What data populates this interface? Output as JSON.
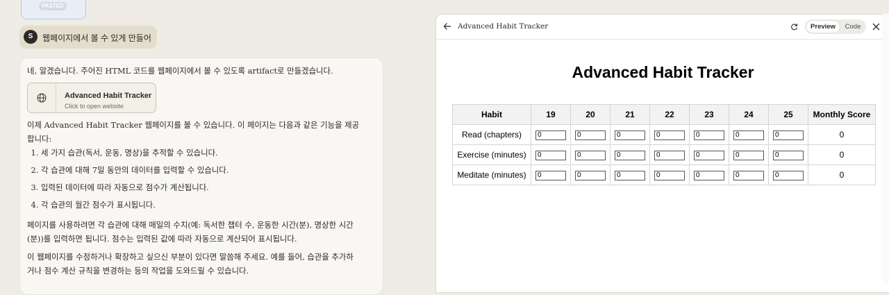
{
  "chat": {
    "pasted_badge": "PASTED",
    "user": {
      "avatar": "S",
      "message": "웹페이지에서 볼 수 있게 만들어"
    },
    "assistant": {
      "intro": "네, 알겠습니다. 주어진 HTML 코드를 웹페이지에서 볼 수 있도록 artifact로 만들겠습니다.",
      "artifact_title": "Advanced Habit Tracker",
      "artifact_subtitle": "Click to open website",
      "paragraph1": "이제 Advanced Habit Tracker 웹페이지를 볼 수 있습니다. 이 페이지는 다음과 같은 기능을 제공합니다:",
      "features": [
        "세 가지 습관(독서, 운동, 명상)을 추적할 수 있습니다.",
        "각 습관에 대해 7일 동안의 데이터를 입력할 수 있습니다.",
        "입력된 데이터에 따라 자동으로 점수가 계산됩니다.",
        "각 습관의 월간 점수가 표시됩니다."
      ],
      "paragraph2": "페이지를 사용하려면 각 습관에 대해 매일의 수치(예: 독서한 챕터 수, 운동한 시간(분), 명상한 시간(분))를 입력하면 됩니다. 점수는 입력된 값에 따라 자동으로 계산되어 표시됩니다.",
      "paragraph3": "이 웹페이지를 수정하거나 확장하고 싶으신 부분이 있다면 말씀해 주세요. 예를 들어, 습관을 추가하거나 점수 계산 규칙을 변경하는 등의 작업을 도와드릴 수 있습니다."
    }
  },
  "panel": {
    "title": "Advanced Habit Tracker",
    "toggle_preview": "Preview",
    "toggle_code": "Code",
    "icons": [
      "back-arrow-icon",
      "refresh-icon",
      "close-icon"
    ],
    "page": {
      "heading": "Advanced Habit Tracker",
      "columns": [
        "Habit",
        "19",
        "20",
        "21",
        "22",
        "23",
        "24",
        "25",
        "Monthly Score"
      ],
      "rows": [
        {
          "habit": "Read (chapters)",
          "values": [
            "0",
            "0",
            "0",
            "0",
            "0",
            "0",
            "0"
          ],
          "score": "0"
        },
        {
          "habit": "Exercise (minutes)",
          "values": [
            "0",
            "0",
            "0",
            "0",
            "0",
            "0",
            "0"
          ],
          "score": "0"
        },
        {
          "habit": "Meditate (minutes)",
          "values": [
            "0",
            "0",
            "0",
            "0",
            "0",
            "0",
            "0"
          ],
          "score": "0"
        }
      ]
    }
  }
}
